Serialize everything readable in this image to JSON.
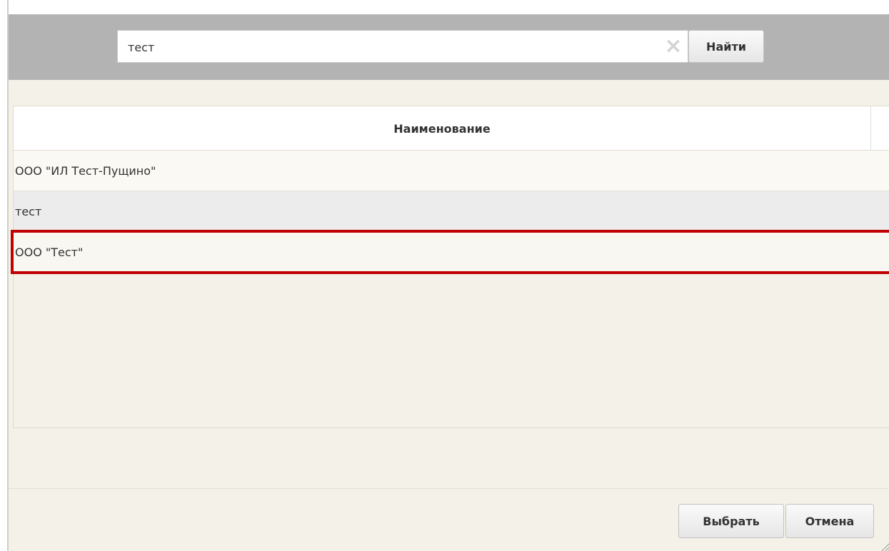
{
  "search": {
    "value": "тест",
    "clear_icon": "×",
    "find_label": "Найти"
  },
  "grid": {
    "column_header": "Наименование",
    "rows": [
      {
        "name": "ООО \"ИЛ Тест-Пущино\""
      },
      {
        "name": "тест"
      },
      {
        "name": "ООО \"Тест\""
      }
    ],
    "selected_row_index": 2,
    "highlight_color": "#c00000"
  },
  "footer": {
    "select_label": "Выбрать",
    "cancel_label": "Отмена"
  }
}
